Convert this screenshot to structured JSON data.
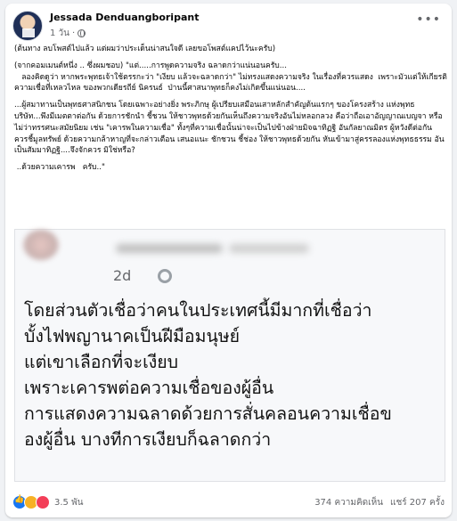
{
  "post": {
    "author": "Jessada Denduangboripant",
    "time": "1 วัน",
    "more_icon": "more-horizontal-icon",
    "privacy_icon": "globe-icon",
    "paragraphs": [
      "(ต้นทาง ลบโพสต์ไปแล้ว แต่ผมว่าประเด็นน่าสนใจดี เลยขอโพสต์แคปไว้นะครับ)",
      "(จากคอมเมนต์หนึ่ง .. ซึ่งผมชอบ) \"แต่.....การพูดความจริง ฉลาดกว่าแน่นอนครับ...\n   ลองคิดดูว่า หากพระพุทธเจ้าใช้ตรรกะว่า \"เงียบ แล้วจะฉลาดกว่า\" ไม่ทรงแสดงความจริง ในเรื่องที่ควรแสดง  เพราะมัวแต่ให้เกียรติความเชื่อที่เหลวไหล ของพวกเดียรถีย์ นิครนธ์  ป่านนี้ศาสนาพุทธก็คงไม่เกิดขึ้นแน่นอน....",
      "...ผู้สมาทานเป็นพุทธศาสนิกชน โดยเฉพาะอย่างยิ่ง พระภิกษุ ผู้เปรียบเสมือนเสาหลักสำคัญต้นแรกๆ ของโครงสร้าง แห่งพุทธบริษัท...พึงมีเมตตาต่อกัน ด้วยการชักนำ ชี้ชวน ให้ชาวพุทธด้วยกันเห็นถึงความจริงอันไม่หลอกลวง คือว่าถือเอาอัญญาณเบญจา หรือไม่ว่าทรรศนะสมัยนิยม เช่น \"เคารพในความเชื่อ\" ทั้งๆที่ความเชื่อนั้นน่าจะเป็นไปข้างฝ่ายมิจฉาทิฏฐิ อันกัลยาณมิตร ผู้หวังดีต่อกัน ควรชี้มูลทรัพย์ ด้วยความกล้าหาญที่จะกล่าวเตือน เสนอแนะ ชักชวน ชี้ช่อง ให้ชาวพุทธด้วยกัน หันเข้ามาสู่ครรลองแห่งพุทธธรรม อันเป็นสัมมาทิฏฐิ....จึงจักควร มิใช่หรือ?",
      " ..ด้วยความเคารพ   ครับ..\""
    ]
  },
  "screenshot": {
    "time": "2d",
    "privacy_icon": "globe-icon",
    "lines": [
      "โดยส่วนตัวเชื่อว่าคนในประเทศนี้มีมากที่เชื่อว่า",
      "บั้งไฟพญานาคเป็นฝีมือมนุษย์",
      "แต่เขาเลือกที่จะเงียบ",
      "เพราะเคารพต่อความเชื่อของผู้อื่น",
      "การแสดงความฉลาดด้วยการสั่นคลอนความเชื่อข",
      "องผู้อื่น บางทีการเงียบก็ฉลาดกว่า"
    ]
  },
  "footer": {
    "reaction_icons": [
      "like-icon",
      "haha-icon",
      "love-icon"
    ],
    "reaction_count": "3.5 พัน",
    "comments": "374 ความคิดเห็น",
    "shares": "แชร์ 207 ครั้ง"
  }
}
